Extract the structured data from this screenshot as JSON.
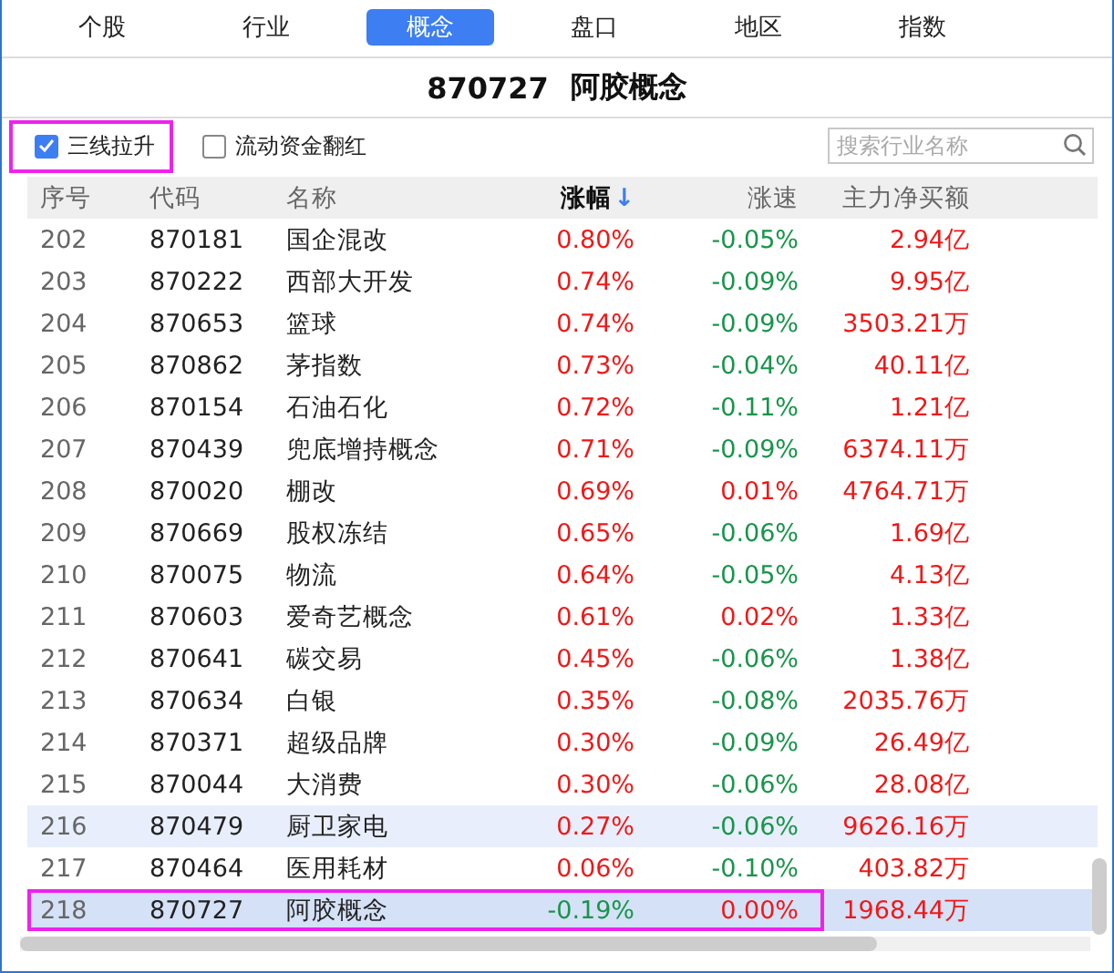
{
  "tabs": [
    {
      "label": "个股",
      "selected": false
    },
    {
      "label": "行业",
      "selected": false
    },
    {
      "label": "概念",
      "selected": true
    },
    {
      "label": "盘口",
      "selected": false
    },
    {
      "label": "地区",
      "selected": false
    },
    {
      "label": "指数",
      "selected": false
    }
  ],
  "title": {
    "code": "870727",
    "name": "阿胶概念"
  },
  "filters": [
    {
      "label": "三线拉升",
      "checked": true,
      "highlighted": true
    },
    {
      "label": "流动资金翻红",
      "checked": false,
      "highlighted": false
    }
  ],
  "search": {
    "placeholder": "搜索行业名称"
  },
  "table": {
    "columns": [
      {
        "label": "序号",
        "sorted": false
      },
      {
        "label": "代码",
        "sorted": false
      },
      {
        "label": "名称",
        "sorted": false
      },
      {
        "label": "涨幅",
        "sorted": true,
        "sort_arrow": "↓"
      },
      {
        "label": "涨速",
        "sorted": false
      },
      {
        "label": "主力净买额",
        "sorted": false
      }
    ],
    "rows": [
      {
        "index": "202",
        "code": "870181",
        "name": "国企混改",
        "change": "0.80%",
        "change_up": true,
        "speed": "-0.05%",
        "speed_up": false,
        "net": "2.94亿",
        "hovered": false,
        "selected": false,
        "highlighted": false
      },
      {
        "index": "203",
        "code": "870222",
        "name": "西部大开发",
        "change": "0.74%",
        "change_up": true,
        "speed": "-0.09%",
        "speed_up": false,
        "net": "9.95亿",
        "hovered": false,
        "selected": false,
        "highlighted": false
      },
      {
        "index": "204",
        "code": "870653",
        "name": "篮球",
        "change": "0.74%",
        "change_up": true,
        "speed": "-0.09%",
        "speed_up": false,
        "net": "3503.21万",
        "hovered": false,
        "selected": false,
        "highlighted": false
      },
      {
        "index": "205",
        "code": "870862",
        "name": "茅指数",
        "change": "0.73%",
        "change_up": true,
        "speed": "-0.04%",
        "speed_up": false,
        "net": "40.11亿",
        "hovered": false,
        "selected": false,
        "highlighted": false
      },
      {
        "index": "206",
        "code": "870154",
        "name": "石油石化",
        "change": "0.72%",
        "change_up": true,
        "speed": "-0.11%",
        "speed_up": false,
        "net": "1.21亿",
        "hovered": false,
        "selected": false,
        "highlighted": false
      },
      {
        "index": "207",
        "code": "870439",
        "name": "兜底增持概念",
        "change": "0.71%",
        "change_up": true,
        "speed": "-0.09%",
        "speed_up": false,
        "net": "6374.11万",
        "hovered": false,
        "selected": false,
        "highlighted": false
      },
      {
        "index": "208",
        "code": "870020",
        "name": "棚改",
        "change": "0.69%",
        "change_up": true,
        "speed": "0.01%",
        "speed_up": true,
        "net": "4764.71万",
        "hovered": false,
        "selected": false,
        "highlighted": false
      },
      {
        "index": "209",
        "code": "870669",
        "name": "股权冻结",
        "change": "0.65%",
        "change_up": true,
        "speed": "-0.06%",
        "speed_up": false,
        "net": "1.69亿",
        "hovered": false,
        "selected": false,
        "highlighted": false
      },
      {
        "index": "210",
        "code": "870075",
        "name": "物流",
        "change": "0.64%",
        "change_up": true,
        "speed": "-0.05%",
        "speed_up": false,
        "net": "4.13亿",
        "hovered": false,
        "selected": false,
        "highlighted": false
      },
      {
        "index": "211",
        "code": "870603",
        "name": "爱奇艺概念",
        "change": "0.61%",
        "change_up": true,
        "speed": "0.02%",
        "speed_up": true,
        "net": "1.33亿",
        "hovered": false,
        "selected": false,
        "highlighted": false
      },
      {
        "index": "212",
        "code": "870641",
        "name": "碳交易",
        "change": "0.45%",
        "change_up": true,
        "speed": "-0.06%",
        "speed_up": false,
        "net": "1.38亿",
        "hovered": false,
        "selected": false,
        "highlighted": false
      },
      {
        "index": "213",
        "code": "870634",
        "name": "白银",
        "change": "0.35%",
        "change_up": true,
        "speed": "-0.08%",
        "speed_up": false,
        "net": "2035.76万",
        "hovered": false,
        "selected": false,
        "highlighted": false
      },
      {
        "index": "214",
        "code": "870371",
        "name": "超级品牌",
        "change": "0.30%",
        "change_up": true,
        "speed": "-0.09%",
        "speed_up": false,
        "net": "26.49亿",
        "hovered": false,
        "selected": false,
        "highlighted": false
      },
      {
        "index": "215",
        "code": "870044",
        "name": "大消费",
        "change": "0.30%",
        "change_up": true,
        "speed": "-0.06%",
        "speed_up": false,
        "net": "28.08亿",
        "hovered": false,
        "selected": false,
        "highlighted": false
      },
      {
        "index": "216",
        "code": "870479",
        "name": "厨卫家电",
        "change": "0.27%",
        "change_up": true,
        "speed": "-0.06%",
        "speed_up": false,
        "net": "9626.16万",
        "hovered": true,
        "selected": false,
        "highlighted": false
      },
      {
        "index": "217",
        "code": "870464",
        "name": "医用耗材",
        "change": "0.06%",
        "change_up": true,
        "speed": "-0.10%",
        "speed_up": false,
        "net": "403.82万",
        "hovered": false,
        "selected": false,
        "highlighted": false
      },
      {
        "index": "218",
        "code": "870727",
        "name": "阿胶概念",
        "change": "-0.19%",
        "change_up": false,
        "speed": "0.00%",
        "speed_up": true,
        "net": "1968.44万",
        "hovered": false,
        "selected": true,
        "highlighted": true
      }
    ]
  }
}
